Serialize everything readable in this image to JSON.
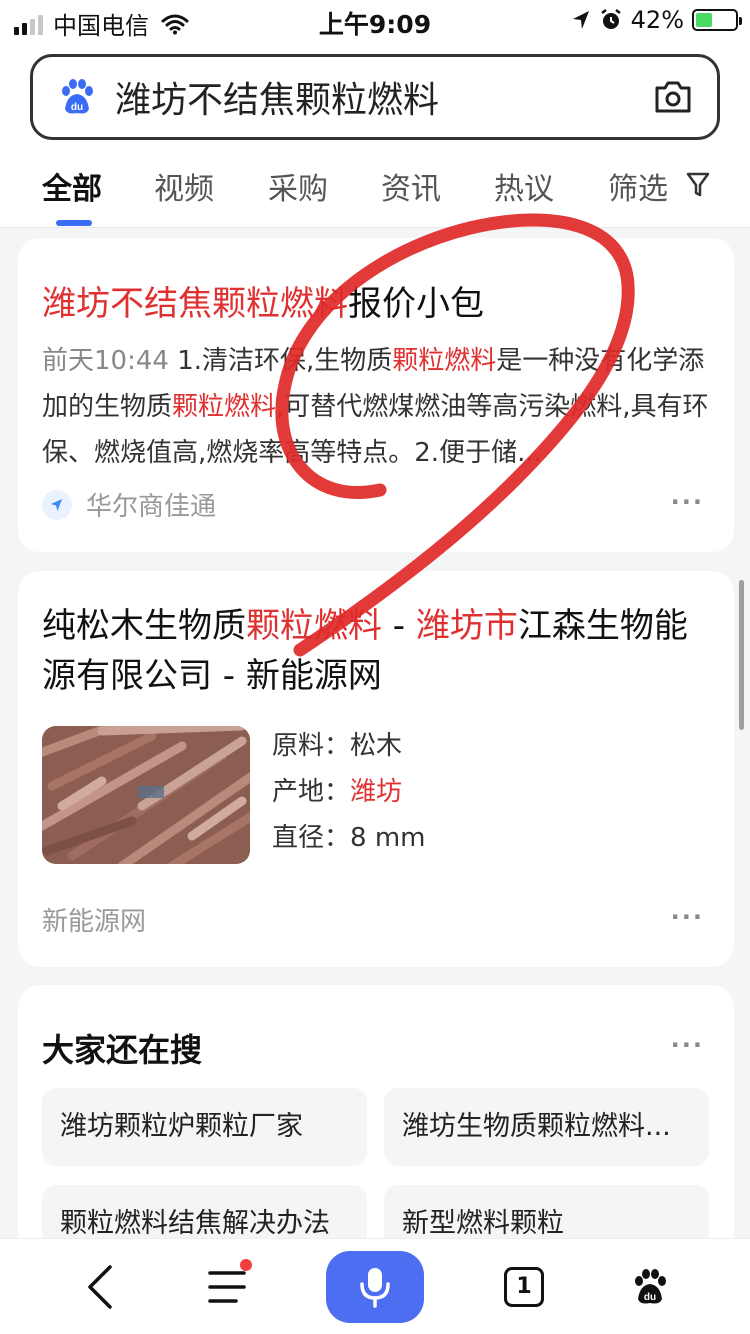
{
  "status_bar": {
    "carrier": "中国电信",
    "time": "上午9:09",
    "battery": "42%",
    "battery_level": 0.42
  },
  "search": {
    "query": "潍坊不结焦颗粒燃料"
  },
  "tabs": [
    {
      "label": "全部",
      "active": true
    },
    {
      "label": "视频"
    },
    {
      "label": "采购"
    },
    {
      "label": "资讯"
    },
    {
      "label": "热议"
    },
    {
      "label": "筛选"
    }
  ],
  "result1": {
    "title_hl": "潍坊不结焦颗粒燃料",
    "title_rest": "报价小包",
    "date": "前天10:44",
    "snippet_parts": [
      "1.清洁环保,生物质",
      "颗粒燃料",
      "是一种没有化学添加的生物质",
      "颗粒燃料",
      ",可替代燃煤燃油等高污染燃料,具有环保、燃烧值高,燃烧率高等特点。2.便于储..."
    ],
    "source": "华尔商佳通",
    "more": "···"
  },
  "result2": {
    "title_parts": [
      "纯松木生物质",
      "颗粒燃料",
      " - ",
      "潍坊市",
      "江森生物能源有限公司 - 新能源网"
    ],
    "attrs": [
      {
        "key": "原料：",
        "value": "松木"
      },
      {
        "key": "产地：",
        "value": "潍坊"
      },
      {
        "key": "直径：",
        "value": "8 mm"
      }
    ],
    "site": "新能源网",
    "more": "···"
  },
  "related": {
    "heading": "大家还在搜",
    "more": "···",
    "items": [
      "潍坊颗粒炉颗粒厂家",
      "潍坊生物质颗粒燃料...",
      "颗粒燃料结焦解决办法",
      "新型燃料颗粒"
    ]
  },
  "toolbar": {
    "tab_count": "1"
  },
  "colors": {
    "highlight": "#e03030",
    "accent": "#4e6ef2",
    "annotation": "#e02a2a"
  }
}
